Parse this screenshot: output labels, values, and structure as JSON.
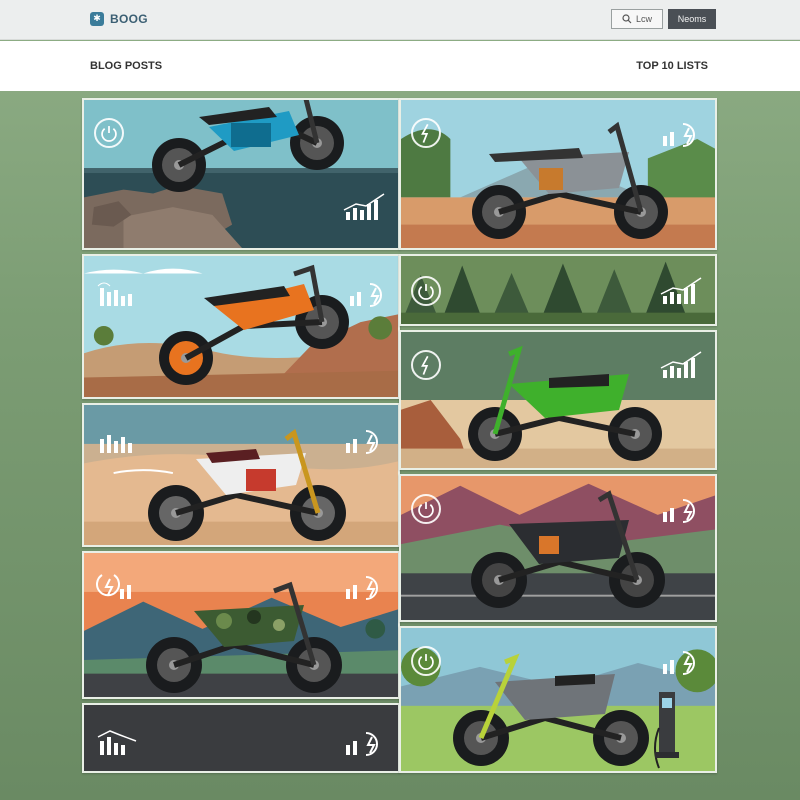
{
  "header": {
    "brand": "BOOG",
    "brand_icon": "logo-icon",
    "search_label": "Lcw",
    "nav_button_label": "Neoms"
  },
  "subheader": {
    "left_label": "BLOG POSTS",
    "right_label": "TOP 10 LISTS"
  },
  "colors": {
    "accent": "#3b7c9a",
    "nav_button": "#4a4f55",
    "page_background": "#7c9d74"
  },
  "cards": [
    {
      "bike_color": "#1f9bc4",
      "scene": "rocks",
      "icon": "power-icon"
    },
    {
      "bike_color": "#8b9196",
      "scene": "dirt-mountain",
      "icon": "lightning-icon"
    },
    {
      "bike_color": "#e8731f",
      "scene": "hills",
      "icon": "chart-icon"
    },
    {
      "bike_color": "#3d5a3b",
      "scene": "forest",
      "icon": "power-icon"
    },
    {
      "bike_color": "#eeeeee",
      "scene": "desert",
      "icon": "chart-icon"
    },
    {
      "bike_color": "#3fb02c",
      "scene": "dirt-cliff",
      "icon": "lightning-icon"
    },
    {
      "bike_color": "#3c5b32",
      "scene": "sunset",
      "icon": "lightning-icon"
    },
    {
      "bike_color": "#2b2d31",
      "scene": "road-mountains",
      "icon": "power-icon"
    },
    {
      "bike_color": "#37393c",
      "scene": "dark",
      "icon": "chart-icon"
    },
    {
      "bike_color": "#6f7479",
      "scene": "meadow-charger",
      "icon": "power-icon"
    }
  ]
}
